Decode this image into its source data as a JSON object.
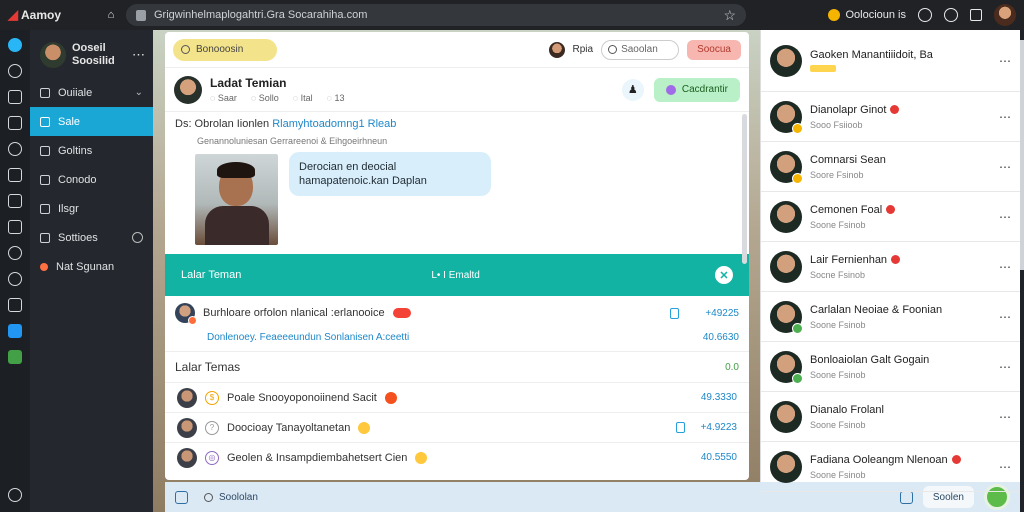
{
  "browser": {
    "brand": "Aamoy",
    "url": "Grigwinhelmaplogahtri.Gra Socarahiha.com",
    "status_label": "Oolocioun is"
  },
  "nav": {
    "profile_name": "Ooseil",
    "profile_sub": "Soosilid",
    "items": [
      {
        "label": "Ouiiale",
        "icon": "list-icon",
        "trail": "⌄"
      },
      {
        "label": "Sale",
        "icon": "chat-icon",
        "active": true
      },
      {
        "label": "Goltins",
        "icon": "doc-icon"
      },
      {
        "label": "Conodo",
        "icon": "group-icon"
      },
      {
        "label": "Ilsgr",
        "icon": "folder-icon"
      },
      {
        "label": "Sottioes",
        "icon": "settings-icon",
        "badge": true
      },
      {
        "label": "Nat Sgunan",
        "icon": "star-icon",
        "cta": true
      }
    ]
  },
  "toolbar": {
    "search_hint": "Bonooosin",
    "user_label": "Rpia",
    "search_placeholder": "Saoolan",
    "action_label": "Soocua"
  },
  "conversation": {
    "title": "Ladat Temian",
    "meta": [
      "Saar",
      "Sollo",
      "Ital",
      "13"
    ],
    "cta_label": "Cacdrantir",
    "message_prefix": "Ds: Obrolan Iionlen",
    "message_link": "Rlamyhtoadomng1 Rleab",
    "message_sub": "Genannoluniesan Gerrareenoi & Eihgoeirhneun",
    "bubble_text": "Derocian en deocial hamapatenoic.kan Daplan"
  },
  "banner": {
    "title": "Lalar Teman",
    "mid": "L• I Emaltd"
  },
  "notice": {
    "text": "Burhloare orfolon nlanical :erlanooice",
    "count": "+49225",
    "link_text": "Donlenoey. Feaeeeundun Sonlanisen A:ceetti",
    "link_num": "40.6630"
  },
  "section": {
    "title": "Lalar Temas",
    "right": "0.0"
  },
  "rows": [
    {
      "text": "Poale Snooyoponoiinend Sacit",
      "right": "49.3330"
    },
    {
      "text": "Doocioay Tanayoltanetan",
      "right": "+4.9223"
    },
    {
      "text": "Geolen & Insampdiembahetsert Cien",
      "right": "40.5550"
    }
  ],
  "bottom": {
    "label": "Soololan",
    "pill": "Soolen"
  },
  "contacts": [
    {
      "name": "Gaoken Manantiiidoit, Ba",
      "sub": "",
      "tag": true
    },
    {
      "name": "Dianolapr Ginot",
      "sub": "Sooo Fsiioob",
      "status": "busy",
      "emo": true
    },
    {
      "name": "Comnarsi Sean",
      "sub": "Soore Fsinob",
      "status": "busy"
    },
    {
      "name": "Cemonen Foal",
      "sub": "Soone Fsinob",
      "emo": true
    },
    {
      "name": "Lair Fernienhan",
      "sub": "Socne Fsinob",
      "emo": true
    },
    {
      "name": "Carlalan Neoiae & Foonian",
      "sub": "Soone Fsinob",
      "status": "on"
    },
    {
      "name": "Bonloaiolan Galt Gogain",
      "sub": "Soone Fsinob",
      "status": "on"
    },
    {
      "name": "Dianalo Frolanl",
      "sub": "Soone Fsinob"
    },
    {
      "name": "Fadiana Ooleangm Nlenoan",
      "sub": "Soone Fsinob",
      "emo": true
    }
  ],
  "colors": {
    "accent": "#1aa7d6",
    "banner": "#12b3a3",
    "sidebar": "#24282e"
  }
}
